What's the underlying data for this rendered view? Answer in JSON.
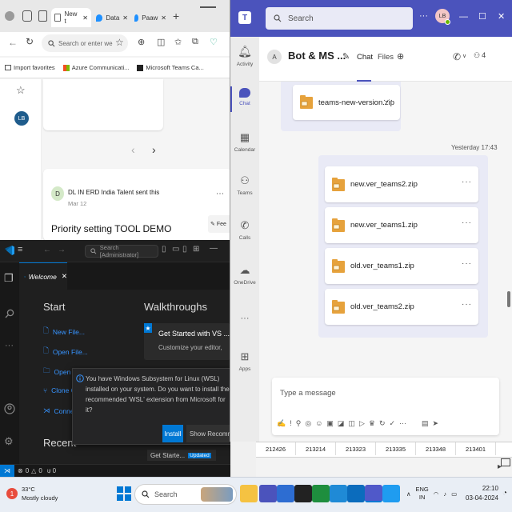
{
  "edge": {
    "tabs": [
      {
        "label": "New t",
        "active": true
      },
      {
        "label": "Data"
      },
      {
        "label": "Paaw"
      }
    ],
    "address_placeholder": "Search or enter we",
    "favorites": [
      "Import favorites",
      "Azure Communicati...",
      "Microsoft Teams Ca..."
    ],
    "avatar_initials": "LB",
    "post": {
      "author": "DL IN ERD India Talent",
      "action": "sent this",
      "date": "Mar 12",
      "title": "Priority setting  TOOL DEMO",
      "avatar_initials": "D",
      "feedback_label": "Fee"
    }
  },
  "vscode": {
    "search_text": "Search [Administrator]",
    "tab_label": "Welcome",
    "start_heading": "Start",
    "start_links": [
      "New File...",
      "Open File...",
      "Open F",
      "Clone G",
      "Connec"
    ],
    "walkthroughs_heading": "Walkthroughs",
    "walkthrough_title": "Get Started with VS ...",
    "walkthrough_desc": "Customize your editor,",
    "recent_heading": "Recent",
    "recent_item": "Get Starte...",
    "updated_badge": "Updated",
    "notification": {
      "message": "You have Windows Subsystem for Linux (WSL) installed on your system. Do you want to install the recommended 'WSL' extension from Microsoft for it?",
      "install_label": "Install",
      "show_label": "Show Recommen"
    },
    "status": {
      "errors": "0",
      "warnings": "0",
      "ports": "0"
    }
  },
  "teams": {
    "search_placeholder": "Search",
    "avatar_initials": "LB",
    "rail": [
      {
        "label": "Activity",
        "icon": "bell-icon"
      },
      {
        "label": "Chat",
        "icon": "chat-icon",
        "active": true
      },
      {
        "label": "Calendar",
        "icon": "calendar-icon"
      },
      {
        "label": "Teams",
        "icon": "teams-icon"
      },
      {
        "label": "Calls",
        "icon": "phone-icon"
      },
      {
        "label": "OneDrive",
        "icon": "cloud-icon"
      },
      {
        "label": "Apps",
        "icon": "apps-icon"
      }
    ],
    "chat_title": "Bot & MS ...",
    "chat_avatar": "A",
    "chat_tab": "Chat",
    "files_tab": "Files",
    "participants_count": "4",
    "first_file": "teams-new-version.zip",
    "timestamp": "Yesterday 17:43",
    "files": [
      "new.ver_teams2.zip",
      "new.ver_teams1.zip",
      "old.ver_teams1.zip",
      "old.ver_teams2.zip"
    ],
    "composer_placeholder": "Type a message",
    "brand_color": "#4b53bc"
  },
  "excel": {
    "cells": [
      "212426",
      "213214",
      "213323",
      "213335",
      "213348",
      "213401"
    ]
  },
  "taskbar": {
    "weather_temp": "33°C",
    "weather_desc": "Mostly cloudy",
    "search_label": "Search",
    "lang_top": "ENG",
    "lang_bottom": "IN",
    "time": "22:10",
    "date": "03-04-2024"
  }
}
